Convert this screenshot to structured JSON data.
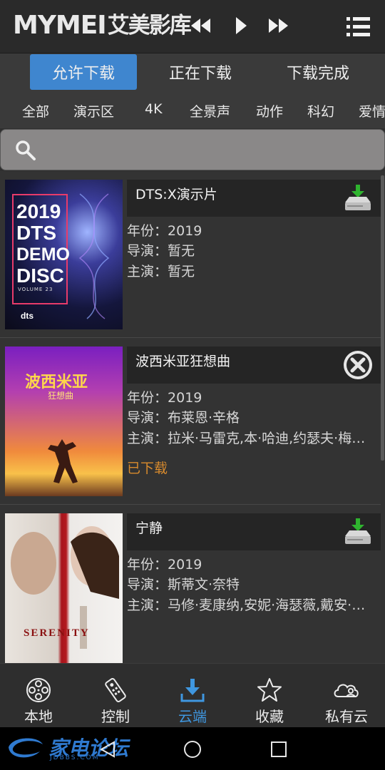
{
  "header": {
    "logo_latin": "MYMEI",
    "logo_cn": "艾美影库",
    "rewind_icon": "rewind-icon",
    "play_icon": "play-icon",
    "forward_icon": "fast-forward-icon",
    "menu_icon": "list-menu-icon"
  },
  "tabs": [
    {
      "label": "允许下载",
      "active": true
    },
    {
      "label": "正在下载",
      "active": false
    },
    {
      "label": "下载完成",
      "active": false
    }
  ],
  "categories": [
    "全部",
    "演示区",
    "4K",
    "全景声",
    "动作",
    "科幻",
    "爱情"
  ],
  "search": {
    "placeholder": "",
    "value": ""
  },
  "items": [
    {
      "title": "DTS:X演示片",
      "year_label": "年份：",
      "year": "2019",
      "director_label": "导演：",
      "director": "暂无",
      "cast_label": "主演：",
      "cast": "暂无",
      "status": "",
      "action_icon": "download-drive-icon",
      "poster": {
        "line1": "2019",
        "line2": "DTS",
        "line3": "DEMO",
        "line4": "DISC",
        "volume": "VOLUME 23",
        "brand": "dts"
      }
    },
    {
      "title": "波西米亚狂想曲",
      "year_label": "年份：",
      "year": "2019",
      "director_label": "导演：",
      "director": "布莱恩·辛格",
      "cast_label": "主演：",
      "cast": "拉米·马雷克,本·哈迪,约瑟夫·梅…",
      "status": "已下载",
      "action_icon": "delete-x-icon",
      "poster": {
        "title": "波西米亚",
        "subtitle": "狂想曲"
      }
    },
    {
      "title": "宁静",
      "year_label": "年份：",
      "year": "2019",
      "director_label": "导演：",
      "director": "斯蒂文·奈特",
      "cast_label": "主演：",
      "cast": "马修·麦康纳,安妮·海瑟薇,戴安·…",
      "status": "",
      "action_icon": "download-drive-icon",
      "poster": {
        "title": "SERENITY"
      }
    }
  ],
  "bottom_nav": [
    {
      "label": "本地",
      "icon": "film-reel-icon",
      "active": false
    },
    {
      "label": "控制",
      "icon": "remote-control-icon",
      "active": false
    },
    {
      "label": "云端",
      "icon": "cloud-download-icon",
      "active": true
    },
    {
      "label": "收藏",
      "icon": "star-icon",
      "active": false
    },
    {
      "label": "私有云",
      "icon": "private-cloud-icon",
      "active": false
    }
  ],
  "watermark": {
    "text": "家电论坛",
    "sub": "JDBBS.COM"
  },
  "colors": {
    "accent": "#3f86cf",
    "active_nav": "#3f97e0",
    "downloaded": "#d98b2d",
    "download_green": "#2fb42f"
  }
}
